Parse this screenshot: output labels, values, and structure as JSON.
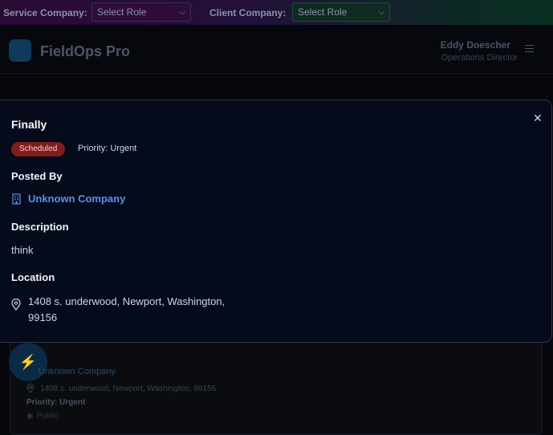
{
  "role_bar": {
    "service_company_label": "Service Company:",
    "service_company_select": "Select Role",
    "client_company_label": "Client Company:",
    "client_company_select": "Select Role"
  },
  "header": {
    "app_name": "FieldOps Pro",
    "user_name": "Eddy Doescher",
    "user_role": "Operations Director"
  },
  "modal": {
    "title": "Finally",
    "status_badge": "Scheduled",
    "priority": "Priority: Urgent",
    "posted_by_heading": "Posted By",
    "company_name": "Unknown Company",
    "description_heading": "Description",
    "description": "think",
    "location_heading": "Location",
    "location_line1": "1408 s. underwood, Newport, Washington,",
    "location_line2": "99156"
  },
  "background_card": {
    "company": "Unknown Company",
    "address": "1408 s. underwood, Newport, Washington, 99156",
    "priority": "Priority: Urgent",
    "visibility": "Public"
  },
  "colors": {
    "accent": "#5b8ef0",
    "status_scheduled": "#7f1d1d",
    "modal_bg": "#060b1c"
  }
}
